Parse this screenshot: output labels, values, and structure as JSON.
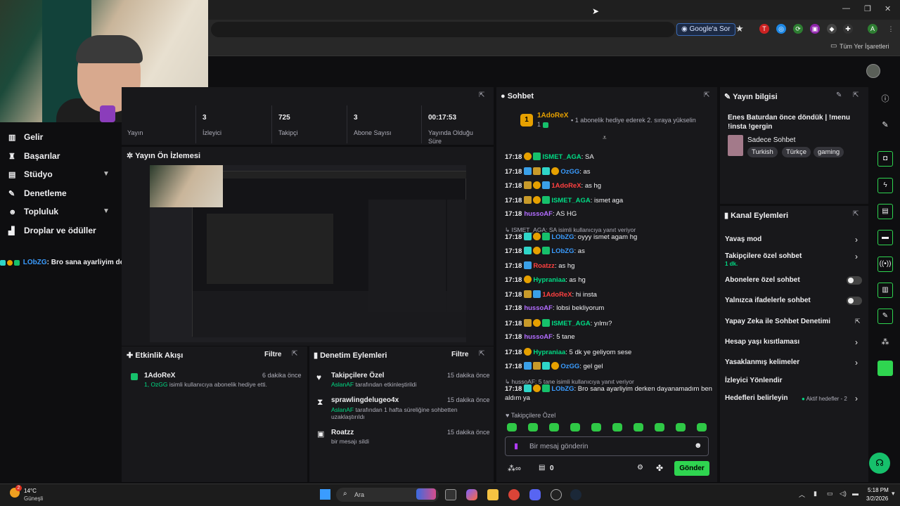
{
  "browser": {
    "google_pill": "Google'a Sor",
    "bookmarks_label": "Tüm Yer İşaretleri",
    "profile_initial": "A"
  },
  "sidebar": {
    "items": [
      {
        "label": "Gelir",
        "icon": "income-icon",
        "glyph": "▥"
      },
      {
        "label": "Başarılar",
        "icon": "trophy-icon",
        "glyph": "♜"
      },
      {
        "label": "Stüdyo",
        "icon": "studio-icon",
        "glyph": "▤",
        "expand": true
      },
      {
        "label": "Denetleme",
        "icon": "wrench-icon",
        "glyph": "✎"
      },
      {
        "label": "Topluluk",
        "icon": "people-icon",
        "glyph": "☻",
        "expand": true
      },
      {
        "label": "Droplar ve ödüller",
        "icon": "drops-icon",
        "glyph": "▟"
      }
    ],
    "ticker_user": "LObZG",
    "ticker_text": ": Bro sana ayarliyim derken dayanamadım b"
  },
  "stats": {
    "items": [
      {
        "value": "",
        "label": "Yayın"
      },
      {
        "value": "3",
        "label": "İzleyici"
      },
      {
        "value": "725",
        "label": "Takipçi"
      },
      {
        "value": "3",
        "label": "Abone Sayısı"
      },
      {
        "value": "00:17:53",
        "label": "Yayında Olduğu Süre"
      }
    ]
  },
  "preview": {
    "title": "Yayın Ön İzlemesi"
  },
  "activity": {
    "title": "Etkinlik Akışı",
    "filter": "Filtre",
    "items": [
      {
        "name": "1AdoReX",
        "time": "6 dakika önce",
        "prefix": "1, OzGG",
        "desc": " isimli kullanıcıya abonelik hediye etti."
      }
    ]
  },
  "mod_actions": {
    "title": "Denetim Eylemleri",
    "filter": "Filtre",
    "items": [
      {
        "name": "Takipçilere Özel",
        "time": "15 dakika önce",
        "who": "AslanAF",
        "desc": " tarafından etkinleştirildi"
      },
      {
        "name": "sprawlingdelugeo4x",
        "time": "15 dakika önce",
        "who": "AslanAF",
        "desc": " tarafından 1 hafta süreliğine sohbetten uzaklaştırıldı"
      },
      {
        "name": "Roatzz",
        "time": "15 dakika önce",
        "who": "",
        "desc": "bir mesajı sildi"
      }
    ]
  },
  "chat": {
    "title": "Sohbet",
    "pinned_user": "1AdoReX",
    "pinned_count": "1",
    "pinned_text": "1 abonelik hediye ederek 2. sıraya yükselin",
    "messages": [
      {
        "time": "17:18",
        "user": "ISMET_AGA",
        "color": "#00db84",
        "badges": [
          "gold",
          "green"
        ],
        "text": ": SA"
      },
      {
        "time": "17:18",
        "user": "OzGG",
        "color": "#3a9cff",
        "badges": [
          "blue",
          "crown",
          "teal",
          "gold"
        ],
        "text": ": as"
      },
      {
        "time": "17:18",
        "user": "1AdoReX",
        "color": "#ff4040",
        "badges": [
          "crown",
          "gold",
          "blue"
        ],
        "text": ": as hg"
      },
      {
        "time": "17:18",
        "user": "ISMET_AGA",
        "color": "#00db84",
        "badges": [
          "crown",
          "gold",
          "green"
        ],
        "text": ": ismet aga"
      },
      {
        "time": "17:18",
        "user": "hussoAF",
        "color": "#b26cff",
        "badges": [],
        "text": ": AS HG"
      },
      {
        "time": "17:18",
        "user": "LObZG",
        "color": "#3a9cff",
        "badges": [
          "teal",
          "gold",
          "green"
        ],
        "text": ": oyyy ismet agam hg",
        "reply": "ISMET_AGA: SA isimli kullanıcıya yanıt veriyor"
      },
      {
        "time": "17:18",
        "user": "LObZG",
        "color": "#3a9cff",
        "badges": [
          "teal",
          "gold",
          "green"
        ],
        "text": ": as"
      },
      {
        "time": "17:18",
        "user": "Roatzz",
        "color": "#ff4040",
        "badges": [
          "blue"
        ],
        "text": ": as hg"
      },
      {
        "time": "17:18",
        "user": "Hypraniaa",
        "color": "#00db84",
        "badges": [
          "gold"
        ],
        "text": ": as hg"
      },
      {
        "time": "17:18",
        "user": "1AdoReX",
        "color": "#ff4040",
        "badges": [
          "crown",
          "blue"
        ],
        "text": ": hi insta"
      },
      {
        "time": "17:18",
        "user": "hussoAF",
        "color": "#b26cff",
        "badges": [],
        "text": ": lobsi bekliyorum"
      },
      {
        "time": "17:18",
        "user": "ISMET_AGA",
        "color": "#00db84",
        "badges": [
          "crown",
          "gold",
          "green"
        ],
        "text": ": yılmı?"
      },
      {
        "time": "17:18",
        "user": "hussoAF",
        "color": "#b26cff",
        "badges": [],
        "text": ": 5 tane"
      },
      {
        "time": "17:18",
        "user": "Hypraniaa",
        "color": "#00db84",
        "badges": [
          "gold"
        ],
        "text": ": 5 dk ye geliyom sese"
      },
      {
        "time": "17:18",
        "user": "OzGG",
        "color": "#3a9cff",
        "badges": [
          "blue",
          "crown",
          "teal",
          "gold"
        ],
        "text": ": gel gel"
      },
      {
        "time": "17:18",
        "user": "LObZG",
        "color": "#3a9cff",
        "badges": [
          "teal",
          "gold",
          "green"
        ],
        "text": ": Bro sana ayarliyim derken dayanamadım ben",
        "text2": "aldım ya",
        "reply": "hussoAF: 5 tane isimli kullanıcıya yanıt veriyor"
      }
    ],
    "mode_label": "Takipçilere Özel",
    "input_placeholder": "Bir mesaj gönderin",
    "points": "0",
    "send": "Gönder"
  },
  "stream_info": {
    "title": "Yayın bilgisi",
    "stream_title": "Enes Baturdan önce döndük | !menu !insta !gergin",
    "category": "Sadece Sohbet",
    "tags": [
      "Turkish",
      "Türkçe",
      "gaming"
    ]
  },
  "channel_actions": {
    "title": "Kanal Eylemleri",
    "items": [
      {
        "label": "Yavaş mod",
        "control": "chevron"
      },
      {
        "label": "Takipçilere özel sohbet",
        "sub": "1 dk.",
        "control": "chevron"
      },
      {
        "label": "Abonelere özel sohbet",
        "control": "toggle"
      },
      {
        "label": "Yalnızca ifadelerle sohbet",
        "control": "toggle"
      },
      {
        "label": "Yapay Zeka ile Sohbet Denetimi",
        "control": "external"
      },
      {
        "label": "Hesap yaşı kısıtlaması",
        "control": "chevron"
      },
      {
        "label": "Yasaklanmış kelimeler",
        "control": "chevron"
      },
      {
        "label": "İzleyici Yönlendir",
        "control": "none"
      },
      {
        "label": "Hedefleri belirleyin",
        "control": "chevron",
        "extra": "Aktif hedefler - 2"
      }
    ]
  },
  "taskbar": {
    "weather_temp": "14°C",
    "weather_desc": "Güneşli",
    "weather_badge": "2",
    "search": "Ara",
    "time": "5:18 PM",
    "date": "3/2/2026"
  }
}
